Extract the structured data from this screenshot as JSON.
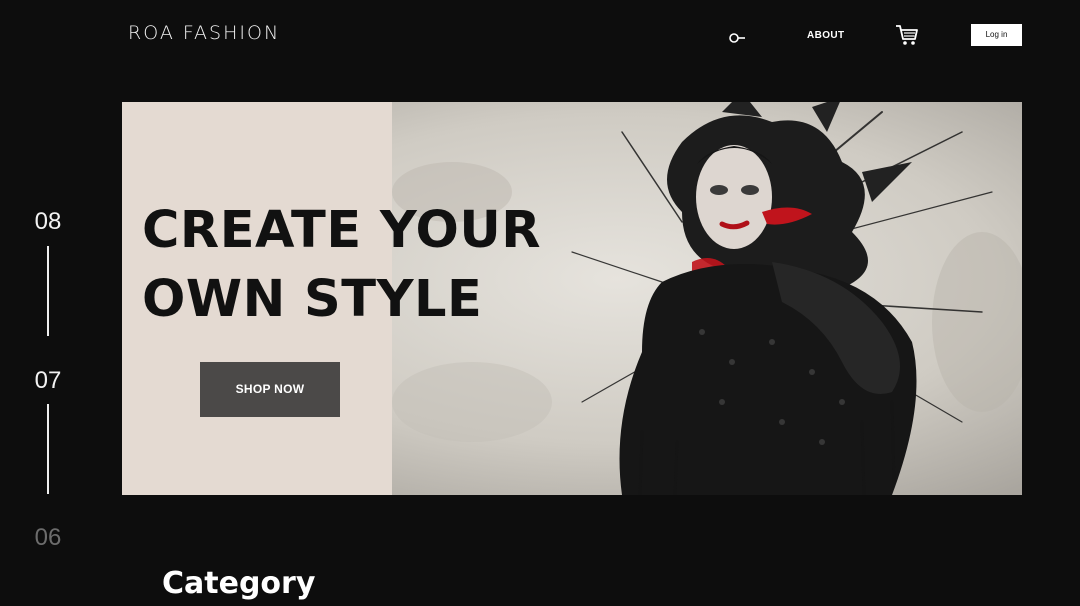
{
  "header": {
    "logo_text": "ROA FASHION",
    "nav": {
      "search_icon": "search-icon",
      "about_label": "ABOUT",
      "cart_icon": "shopping-cart-icon",
      "login_label": "Log in"
    }
  },
  "slide_counter": {
    "current": "08",
    "next": "07",
    "after": "06"
  },
  "hero": {
    "title_line1": "CREATE YOUR",
    "title_line2": "OWN STYLE",
    "cta_label": "SHOP NOW",
    "image_subject": "woman in black feathered fashion artwork with ink splashes"
  },
  "section": {
    "heading": "Category"
  },
  "colors": {
    "background": "#0d0d0d",
    "panel": "#e4dad2",
    "button": "#4b4948",
    "accent_red": "#c0141c"
  }
}
